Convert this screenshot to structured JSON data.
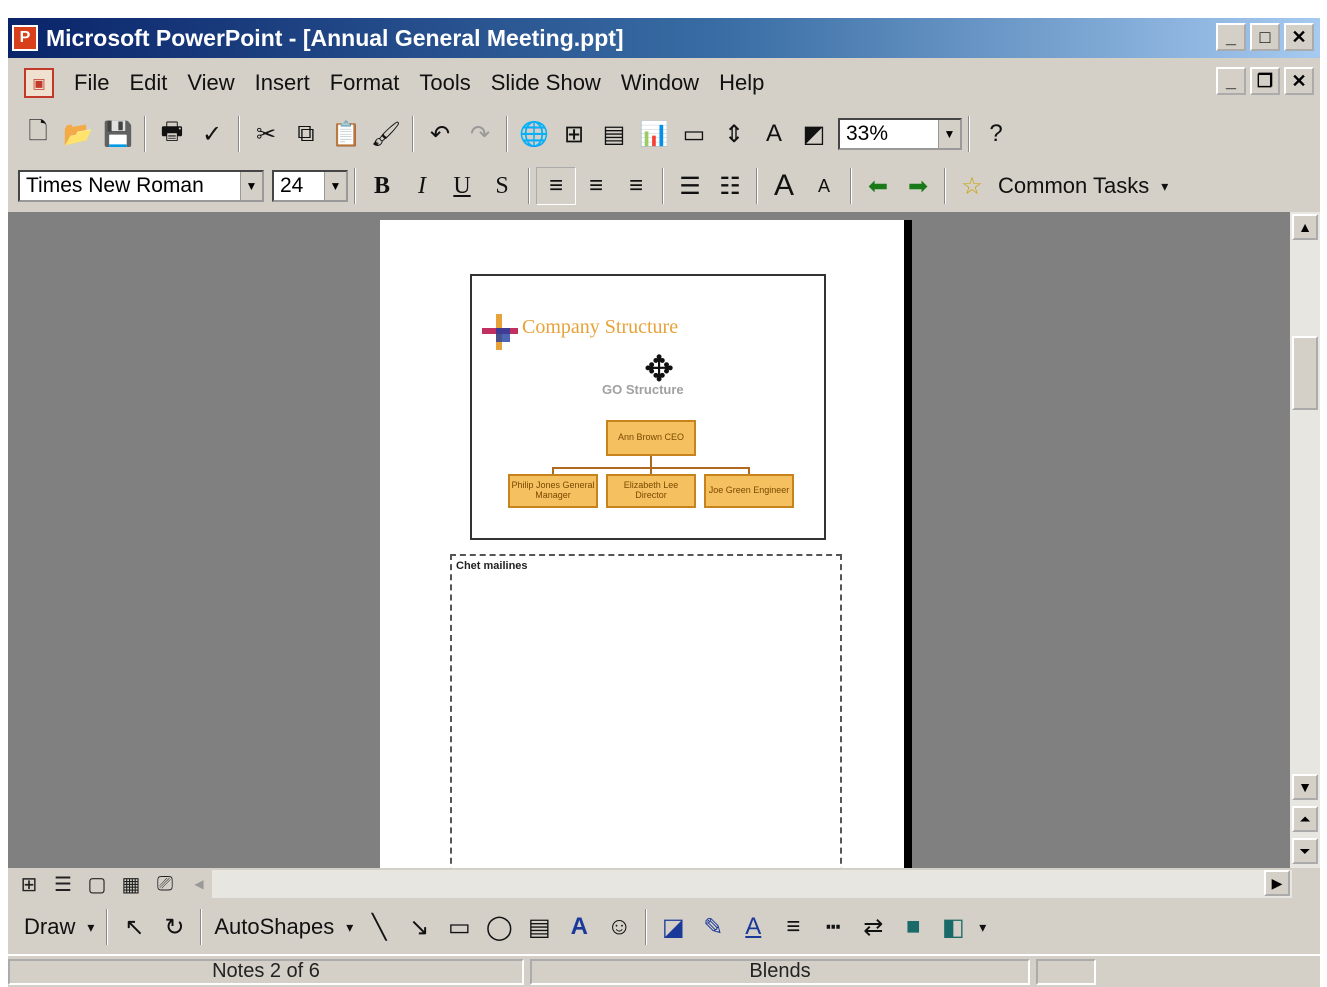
{
  "window": {
    "title": "Microsoft PowerPoint - [Annual General Meeting.ppt]",
    "controls": [
      "_",
      "□",
      "✕"
    ]
  },
  "menu": {
    "items": [
      "File",
      "Edit",
      "View",
      "Insert",
      "Format",
      "Tools",
      "Slide Show",
      "Window",
      "Help"
    ]
  },
  "toolbar": {
    "zoom": "33%",
    "font_name": "Times New Roman",
    "font_size": "24",
    "common_tasks": "Common Tasks"
  },
  "slide": {
    "title": "Company Structure",
    "subtitle_label": "GO Structure",
    "boxes": [
      "Ann Brown CEO",
      "Philip Jones General Manager",
      "Elizabeth Lee Director",
      "Joe Green Engineer"
    ]
  },
  "notes": {
    "label": "Chet mailines"
  },
  "draw": {
    "draw_label": "Draw",
    "autoshapes_label": "AutoShapes"
  },
  "status": {
    "left": "Notes 2 of 6",
    "center": "Blends"
  },
  "colors": {
    "titlebar_start": "#0a246a",
    "titlebar_end": "#a6caf0",
    "chrome": "#d4d0c8",
    "workspace": "#808080",
    "org_box_fill": "#f5c060",
    "slide_title": "#e8a23a"
  }
}
